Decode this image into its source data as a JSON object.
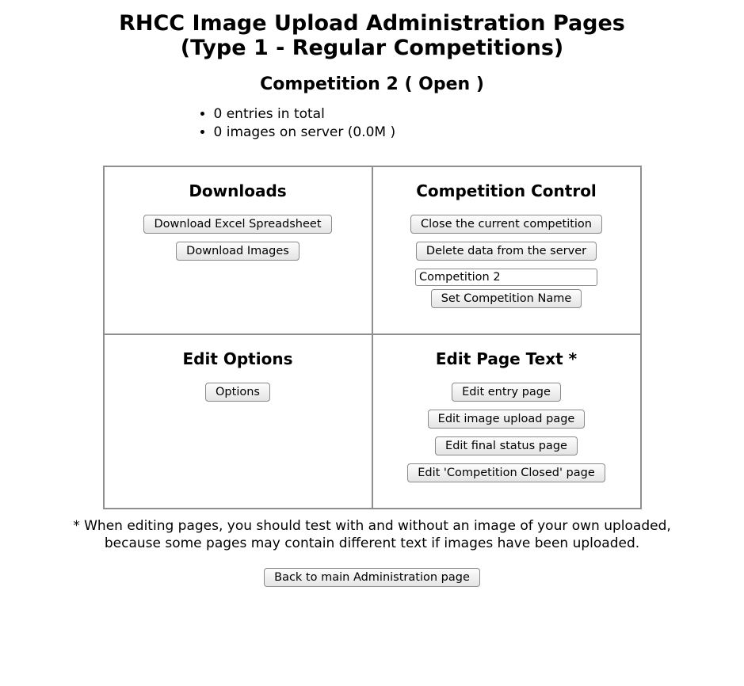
{
  "header": {
    "title_line1": "RHCC Image Upload Administration Pages",
    "title_line2": "(Type 1 - Regular Competitions)",
    "subtitle": "Competition 2 ( Open )"
  },
  "stats": {
    "entries": "0 entries in total",
    "images": "0 images on server (0.0M )"
  },
  "panels": {
    "downloads": {
      "title": "Downloads",
      "excel_btn": "Download Excel Spreadsheet",
      "images_btn": "Download Images"
    },
    "control": {
      "title": "Competition Control",
      "close_btn": "Close the current competition",
      "delete_btn": "Delete data from the server",
      "name_value": "Competition 2",
      "setname_btn": "Set Competition Name"
    },
    "options": {
      "title": "Edit Options",
      "options_btn": "Options"
    },
    "pagetext": {
      "title": "Edit Page Text *",
      "entry_btn": "Edit entry page",
      "upload_btn": "Edit image upload page",
      "status_btn": "Edit final status page",
      "closed_btn": "Edit 'Competition Closed' page"
    }
  },
  "footnote": "* When editing pages, you should test with and without an image of your own uploaded, because some pages may contain different text if images have been uploaded.",
  "footer": {
    "back_btn": "Back to main Administration page"
  }
}
